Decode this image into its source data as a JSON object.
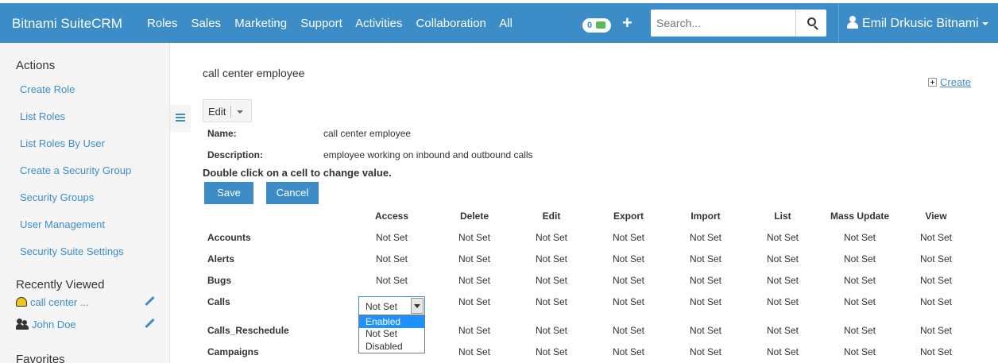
{
  "topnav": {
    "brand": "Bitnami SuiteCRM",
    "menu": [
      "Roles",
      "Sales",
      "Marketing",
      "Support",
      "Activities",
      "Collaboration",
      "All"
    ],
    "notification_count": "0",
    "search_placeholder": "Search...",
    "user_name": "Emil Drkusic Bitnami"
  },
  "sidebar": {
    "actions_heading": "Actions",
    "actions": [
      "Create Role",
      "List Roles",
      "List Roles By User",
      "Create a Security Group",
      "Security Groups",
      "User Management",
      "Security Suite Settings"
    ],
    "recent_heading": "Recently Viewed",
    "recent": [
      "call center ...",
      "John Doe"
    ],
    "favorites_heading": "Favorites"
  },
  "main": {
    "title": "call center employee",
    "create_label": "Create",
    "edit_label": "Edit",
    "name_label": "Name:",
    "name_value": "call center employee",
    "description_label": "Description:",
    "description_value": "employee working on inbound and outbound calls",
    "hint": "Double click on a cell to change value.",
    "save_label": "Save",
    "cancel_label": "Cancel"
  },
  "table": {
    "columns": [
      "Access",
      "Delete",
      "Edit",
      "Export",
      "Import",
      "List",
      "Mass Update",
      "View"
    ],
    "rows": [
      {
        "name": "Accounts",
        "cells": [
          "Not Set",
          "Not Set",
          "Not Set",
          "Not Set",
          "Not Set",
          "Not Set",
          "Not Set",
          "Not Set"
        ]
      },
      {
        "name": "Alerts",
        "cells": [
          "Not Set",
          "Not Set",
          "Not Set",
          "Not Set",
          "Not Set",
          "Not Set",
          "Not Set",
          "Not Set"
        ]
      },
      {
        "name": "Bugs",
        "cells": [
          "Not Set",
          "Not Set",
          "Not Set",
          "Not Set",
          "Not Set",
          "Not Set",
          "Not Set",
          "Not Set"
        ]
      },
      {
        "name": "Calls",
        "cells": [
          "Not Set",
          "Not Set",
          "Not Set",
          "Not Set",
          "Not Set",
          "Not Set",
          "Not Set",
          "Not Set"
        ]
      },
      {
        "name": "Calls_Reschedule",
        "cells": [
          "",
          "Not Set",
          "Not Set",
          "Not Set",
          "Not Set",
          "Not Set",
          "Not Set",
          "Not Set"
        ]
      },
      {
        "name": "Campaigns",
        "cells": [
          "",
          "Not Set",
          "Not Set",
          "Not Set",
          "Not Set",
          "Not Set",
          "Not Set",
          "Not Set"
        ]
      }
    ],
    "select_value": "Not Set",
    "select_options": [
      "Enabled",
      "Not Set",
      "Disabled"
    ]
  }
}
